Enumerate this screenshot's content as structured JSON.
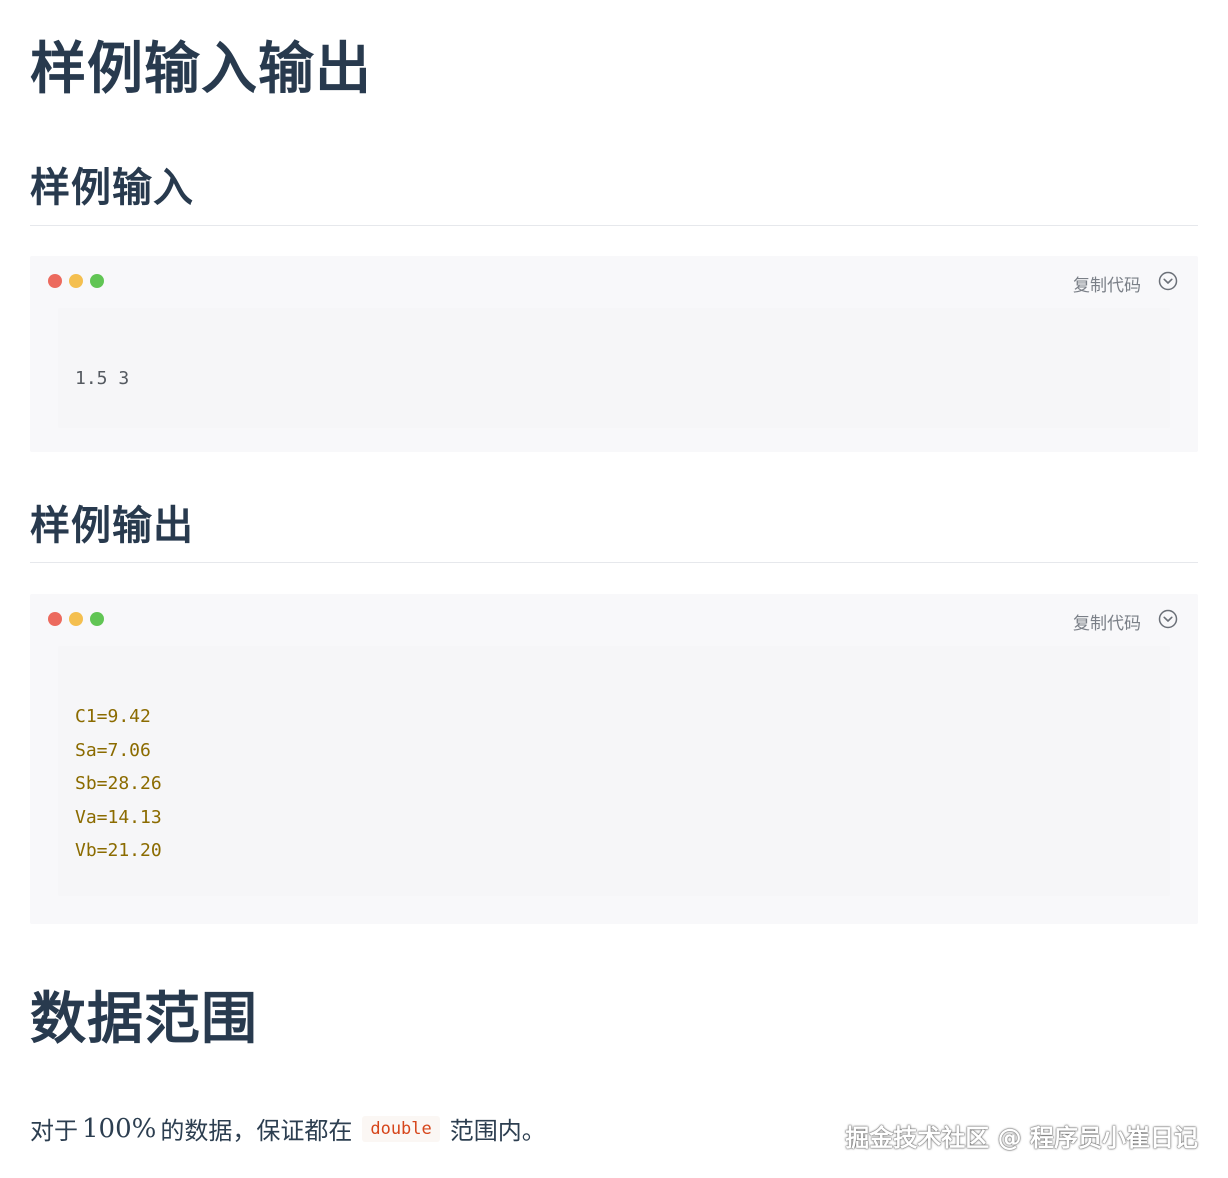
{
  "sections": {
    "io_title": "样例输入输出",
    "input_title": "样例输入",
    "output_title": "样例输出",
    "range_title": "数据范围"
  },
  "code_toolbar": {
    "copy_label": "复制代码",
    "expand_icon": "chevron-down-circle-icon",
    "dot_colors": [
      "#ec6a5e",
      "#f4bf4f",
      "#61c554"
    ]
  },
  "input_block": {
    "lines": [
      "1.5 3"
    ]
  },
  "output_block": {
    "lines": [
      "C1=9.42",
      "Sa=7.06",
      "Sb=28.26",
      "Va=14.13",
      "Vb=21.20"
    ]
  },
  "range_paragraph": {
    "prefix": "对于",
    "percent": "100%",
    "middle": "的数据，保证都在",
    "code": "double",
    "suffix": "范围内。"
  },
  "watermark": "掘金技术社区 @ 程序员小崔日记"
}
